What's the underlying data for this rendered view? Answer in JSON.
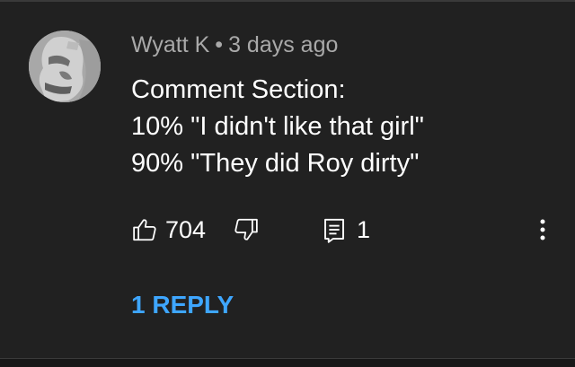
{
  "comment": {
    "author": "Wyatt K",
    "separator": "•",
    "timestamp": "3 days ago",
    "lines": [
      "Comment Section:",
      "10% \"I didn't like that girl\"",
      "90% \"They did Roy dirty\""
    ]
  },
  "actions": {
    "like_count": "704",
    "reply_count": "1",
    "icons": {
      "like": "thumbs-up-icon",
      "dislike": "thumbs-down-icon",
      "reply": "comment-icon",
      "more": "more-vertical-icon"
    }
  },
  "replies_link": "1 REPLY",
  "colors": {
    "background": "#212121",
    "meta_text": "#a9a9a9",
    "body_text": "#ffffff",
    "link": "#3ea6ff"
  }
}
